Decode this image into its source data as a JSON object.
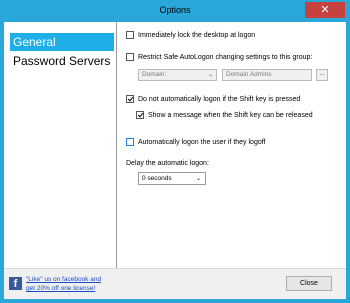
{
  "window": {
    "title": "Options",
    "close_glyph": "✕"
  },
  "sidebar": {
    "items": [
      {
        "label": "General",
        "active": true
      },
      {
        "label": "Password Servers",
        "active": false
      }
    ]
  },
  "settings": {
    "lock_desktop": {
      "label": "Immediately lock the desktop at logon",
      "checked": false
    },
    "restrict_group": {
      "label": "Restrict Safe AutoLogon changing settings to this group:",
      "checked": false
    },
    "group_domain": {
      "value": "Domain:"
    },
    "group_name": {
      "value": "Domain Admins"
    },
    "group_browse": {
      "label": "..."
    },
    "no_shift_logon": {
      "label": "Do not automatically logon if the Shift key is pressed",
      "checked": true
    },
    "shift_message": {
      "label": "Show a message when the Shift key can be released",
      "checked": true
    },
    "auto_logon_after_logoff": {
      "label": "Automatically logon the user if they logoff",
      "checked": false
    },
    "delay": {
      "label": "Delay the automatic logon:",
      "value": "0 seconds"
    }
  },
  "footer": {
    "facebook_icon": "f",
    "facebook_line1": "\"Like\" us on facebook and",
    "facebook_line2": "get 20% off one license!",
    "close_label": "Close"
  },
  "icons": {
    "dropdown_arrow": "⌄"
  }
}
